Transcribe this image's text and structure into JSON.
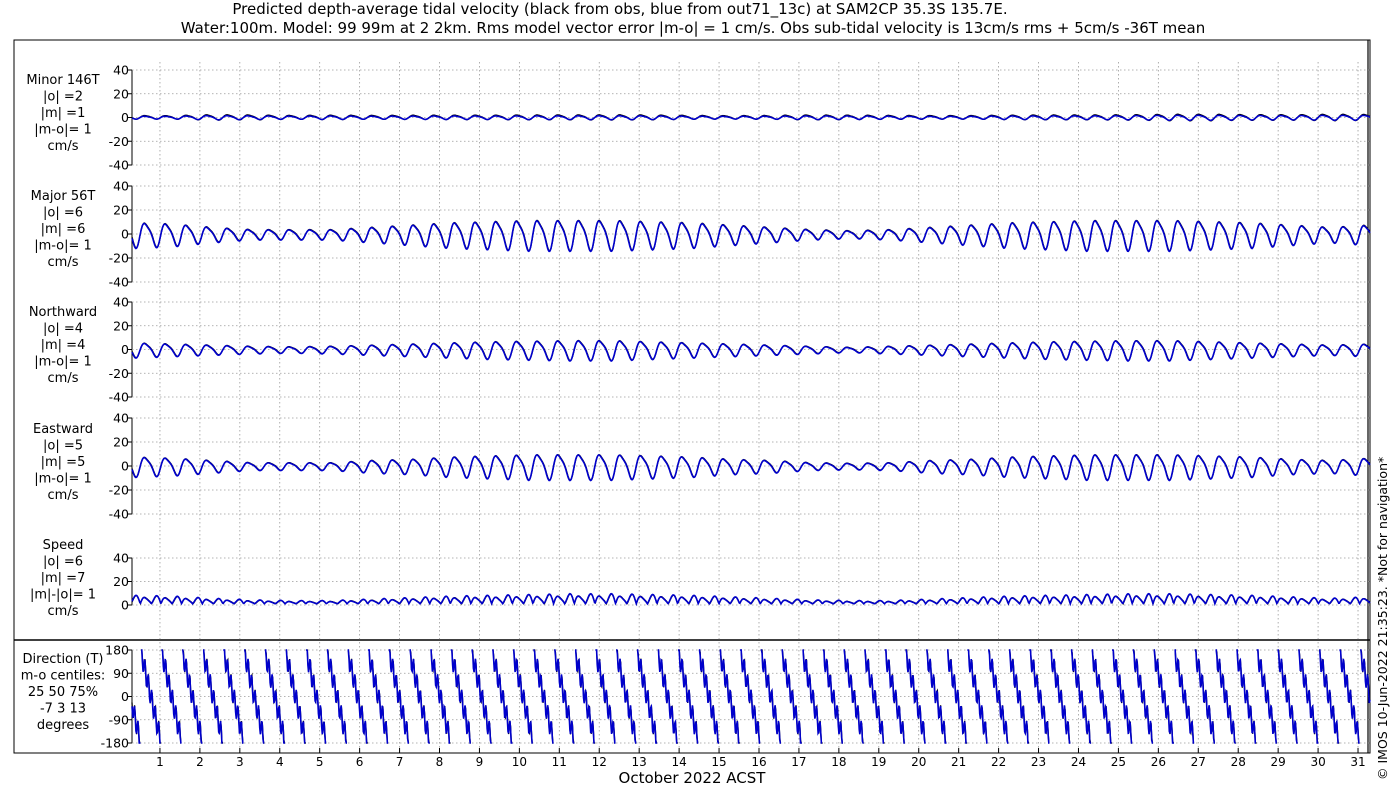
{
  "title": {
    "line1": "Predicted depth-average tidal velocity (black from obs, blue from out71_13c) at SAM2CP 35.3S 135.7E.",
    "line2": "Water:100m. Model: 99 99m at 2 2km. Rms model vector error |m-o| = 1 cm/s. Obs sub-tidal velocity is 13cm/s rms + 5cm/s -36T mean"
  },
  "xlabel": "October 2022 ACST",
  "credit": "© IMOS 10-Jun-2022 21:35:23. *Not for navigation*",
  "colors": {
    "obs": "#000000",
    "model": "#0000cc",
    "grid": "#9a9a9a"
  },
  "chart_data": [
    {
      "type": "line",
      "name": "minor",
      "label_lines": [
        "Minor 146T",
        "|o| =2",
        "|m| =1",
        "|m-o|= 1",
        "cm/s"
      ],
      "ylim": [
        -40,
        40
      ],
      "yticks": [
        40,
        20,
        0,
        -20,
        -40
      ],
      "xlim": [
        0.3,
        31.3
      ],
      "xticks": [
        1,
        2,
        3,
        4,
        5,
        6,
        7,
        8,
        9,
        10,
        11,
        12,
        13,
        14,
        15,
        16,
        17,
        18,
        19,
        20,
        21,
        22,
        23,
        24,
        25,
        26,
        27,
        28,
        29,
        30,
        31
      ],
      "series": [
        {
          "name": "obs",
          "role": "obs",
          "amp": [
            1.5,
            1.4,
            2.2,
            2.0,
            1.6,
            1.8,
            1.6,
            1.7,
            1.8,
            1.8,
            2.0,
            2.0,
            2.1,
            2.0,
            1.6,
            1.4,
            1.6,
            2.0,
            1.8,
            1.6,
            1.5,
            1.5,
            1.8,
            2.0,
            2.0,
            2.2,
            2.6,
            2.6,
            2.3,
            2.2,
            2.6,
            2.4
          ],
          "offset": 0.3,
          "phase": 0.0
        },
        {
          "name": "model",
          "role": "model",
          "amp": [
            1.2,
            1.1,
            1.7,
            1.5,
            1.2,
            1.4,
            1.2,
            1.3,
            1.4,
            1.4,
            1.5,
            1.5,
            1.6,
            1.5,
            1.2,
            1.1,
            1.2,
            1.5,
            1.4,
            1.2,
            1.1,
            1.1,
            1.4,
            1.5,
            1.5,
            1.7,
            2.0,
            2.0,
            1.8,
            1.7,
            2.0,
            1.9
          ],
          "offset": 0.0,
          "phase": 0.08
        }
      ]
    },
    {
      "type": "line",
      "name": "major",
      "label_lines": [
        "Major 56T",
        "|o| =6",
        "|m| =6",
        "|m-o|= 1",
        "cm/s"
      ],
      "ylim": [
        -40,
        40
      ],
      "yticks": [
        40,
        20,
        0,
        -20,
        -40
      ],
      "xlim": [
        0.3,
        31.3
      ],
      "xticks": [
        1,
        2,
        3,
        4,
        5,
        6,
        7,
        8,
        9,
        10,
        11,
        12,
        13,
        14,
        15,
        16,
        17,
        18,
        19,
        20,
        21,
        22,
        23,
        24,
        25,
        26,
        27,
        28,
        29,
        30,
        31
      ],
      "series": [
        {
          "name": "obs",
          "role": "obs",
          "amp": [
            10,
            9,
            6,
            4,
            4,
            4,
            6,
            8,
            10,
            11,
            12,
            12,
            12,
            11,
            10,
            8,
            6,
            4,
            3,
            4,
            6,
            8,
            10,
            11,
            12,
            12,
            12,
            11,
            10,
            8,
            6,
            8
          ],
          "offset": 0.0,
          "phase": 0.0
        },
        {
          "name": "model",
          "role": "model",
          "amp": [
            10,
            9,
            6,
            4,
            4,
            4,
            6,
            8,
            10,
            11,
            12,
            12,
            12,
            11,
            10,
            8,
            6,
            4,
            3,
            4,
            6,
            8,
            10,
            11,
            12,
            12,
            12,
            11,
            10,
            8,
            6,
            8
          ],
          "offset": -0.4,
          "phase": 0.06
        }
      ]
    },
    {
      "type": "line",
      "name": "northward",
      "label_lines": [
        "Northward",
        "|o| =4",
        "|m| =4",
        "|m-o|= 1",
        "cm/s"
      ],
      "ylim": [
        -40,
        40
      ],
      "yticks": [
        40,
        20,
        0,
        -20,
        -40
      ],
      "xlim": [
        0.3,
        31.3
      ],
      "xticks": [
        1,
        2,
        3,
        4,
        5,
        6,
        7,
        8,
        9,
        10,
        11,
        12,
        13,
        14,
        15,
        16,
        17,
        18,
        19,
        20,
        21,
        22,
        23,
        24,
        25,
        26,
        27,
        28,
        29,
        30,
        31
      ],
      "series": [
        {
          "name": "obs",
          "role": "obs",
          "amp": [
            6,
            5,
            4,
            3,
            2.5,
            3,
            4,
            5,
            6,
            7,
            7.5,
            8,
            8,
            7,
            6,
            5,
            4,
            3,
            2,
            3,
            4,
            5,
            6,
            7,
            7.5,
            8,
            8,
            7,
            6,
            5,
            4,
            5
          ],
          "offset": 0.0,
          "phase": 0.0
        },
        {
          "name": "model",
          "role": "model",
          "amp": [
            6,
            5,
            4,
            3,
            2.5,
            3,
            4,
            5,
            6,
            7,
            7.5,
            8,
            8,
            7,
            6,
            5,
            4,
            3,
            2,
            3,
            4,
            5,
            6,
            7,
            7.5,
            8,
            8,
            7,
            6,
            5,
            4,
            5
          ],
          "offset": -0.3,
          "phase": 0.07
        }
      ]
    },
    {
      "type": "line",
      "name": "eastward",
      "label_lines": [
        "Eastward",
        "|o| =5",
        "|m| =5",
        "|m-o|= 1",
        "cm/s"
      ],
      "ylim": [
        -40,
        40
      ],
      "yticks": [
        40,
        20,
        0,
        -20,
        -40
      ],
      "xlim": [
        0.3,
        31.3
      ],
      "xticks": [
        1,
        2,
        3,
        4,
        5,
        6,
        7,
        8,
        9,
        10,
        11,
        12,
        13,
        14,
        15,
        16,
        17,
        18,
        19,
        20,
        21,
        22,
        23,
        24,
        25,
        26,
        27,
        28,
        29,
        30,
        31
      ],
      "series": [
        {
          "name": "obs",
          "role": "obs",
          "amp": [
            8,
            7,
            5,
            3,
            3,
            3,
            5,
            6,
            8,
            9,
            10,
            10,
            10,
            9,
            8,
            6,
            5,
            3,
            2.5,
            3,
            5,
            6,
            8,
            9,
            10,
            10,
            10,
            9,
            8,
            6,
            5,
            7
          ],
          "offset": 0.0,
          "phase": 0.0
        },
        {
          "name": "model",
          "role": "model",
          "amp": [
            8,
            7,
            5,
            3,
            3,
            3,
            5,
            6,
            8,
            9,
            10,
            10,
            10,
            9,
            8,
            6,
            5,
            3,
            2.5,
            3,
            5,
            6,
            8,
            9,
            10,
            10,
            10,
            9,
            8,
            6,
            5,
            7
          ],
          "offset": -0.3,
          "phase": 0.06
        }
      ]
    },
    {
      "type": "line",
      "name": "speed",
      "label_lines": [
        "Speed",
        "|o| =6",
        "|m| =7",
        "|m|-|o|= 1",
        "cm/s"
      ],
      "ylim": [
        0,
        40
      ],
      "yticks": [
        40,
        20,
        0
      ],
      "xlim": [
        0.3,
        31.3
      ],
      "xticks": [
        1,
        2,
        3,
        4,
        5,
        6,
        7,
        8,
        9,
        10,
        11,
        12,
        13,
        14,
        15,
        16,
        17,
        18,
        19,
        20,
        21,
        22,
        23,
        24,
        25,
        26,
        27,
        28,
        29,
        30,
        31
      ],
      "series": [
        {
          "name": "obs",
          "role": "obs",
          "amp": [
            11,
            10,
            7,
            5,
            4,
            4,
            6,
            8,
            10,
            11,
            12,
            13,
            13,
            12,
            11,
            9,
            7,
            5,
            4,
            4,
            6,
            8,
            10,
            11,
            12,
            13,
            13,
            12,
            11,
            9,
            7,
            9
          ],
          "offset": 0.0,
          "phase": 0.0
        },
        {
          "name": "model",
          "role": "model",
          "amp": [
            11,
            10,
            7,
            5,
            4,
            4,
            6,
            8,
            10,
            11,
            12,
            13,
            13,
            12,
            11,
            9,
            7,
            5,
            4,
            4,
            6,
            8,
            10,
            11,
            12,
            13,
            13,
            12,
            11,
            9,
            7,
            9
          ],
          "offset": -0.4,
          "phase": 0.05
        }
      ]
    },
    {
      "type": "line",
      "name": "direction",
      "label_lines": [
        "Direction (T)",
        "m-o centiles:",
        "25  50  75%",
        "-7   3  13",
        "degrees"
      ],
      "ylim": [
        -180,
        180
      ],
      "yticks": [
        180,
        90,
        0,
        -90,
        -180
      ],
      "xlim": [
        0.3,
        31.3
      ],
      "xticks": [
        1,
        2,
        3,
        4,
        5,
        6,
        7,
        8,
        9,
        10,
        11,
        12,
        13,
        14,
        15,
        16,
        17,
        18,
        19,
        20,
        21,
        22,
        23,
        24,
        25,
        26,
        27,
        28,
        29,
        30,
        31
      ],
      "series": [
        {
          "name": "obs",
          "role": "obs",
          "phase": 0.0
        },
        {
          "name": "model",
          "role": "model",
          "phase": 0.05
        }
      ]
    }
  ]
}
